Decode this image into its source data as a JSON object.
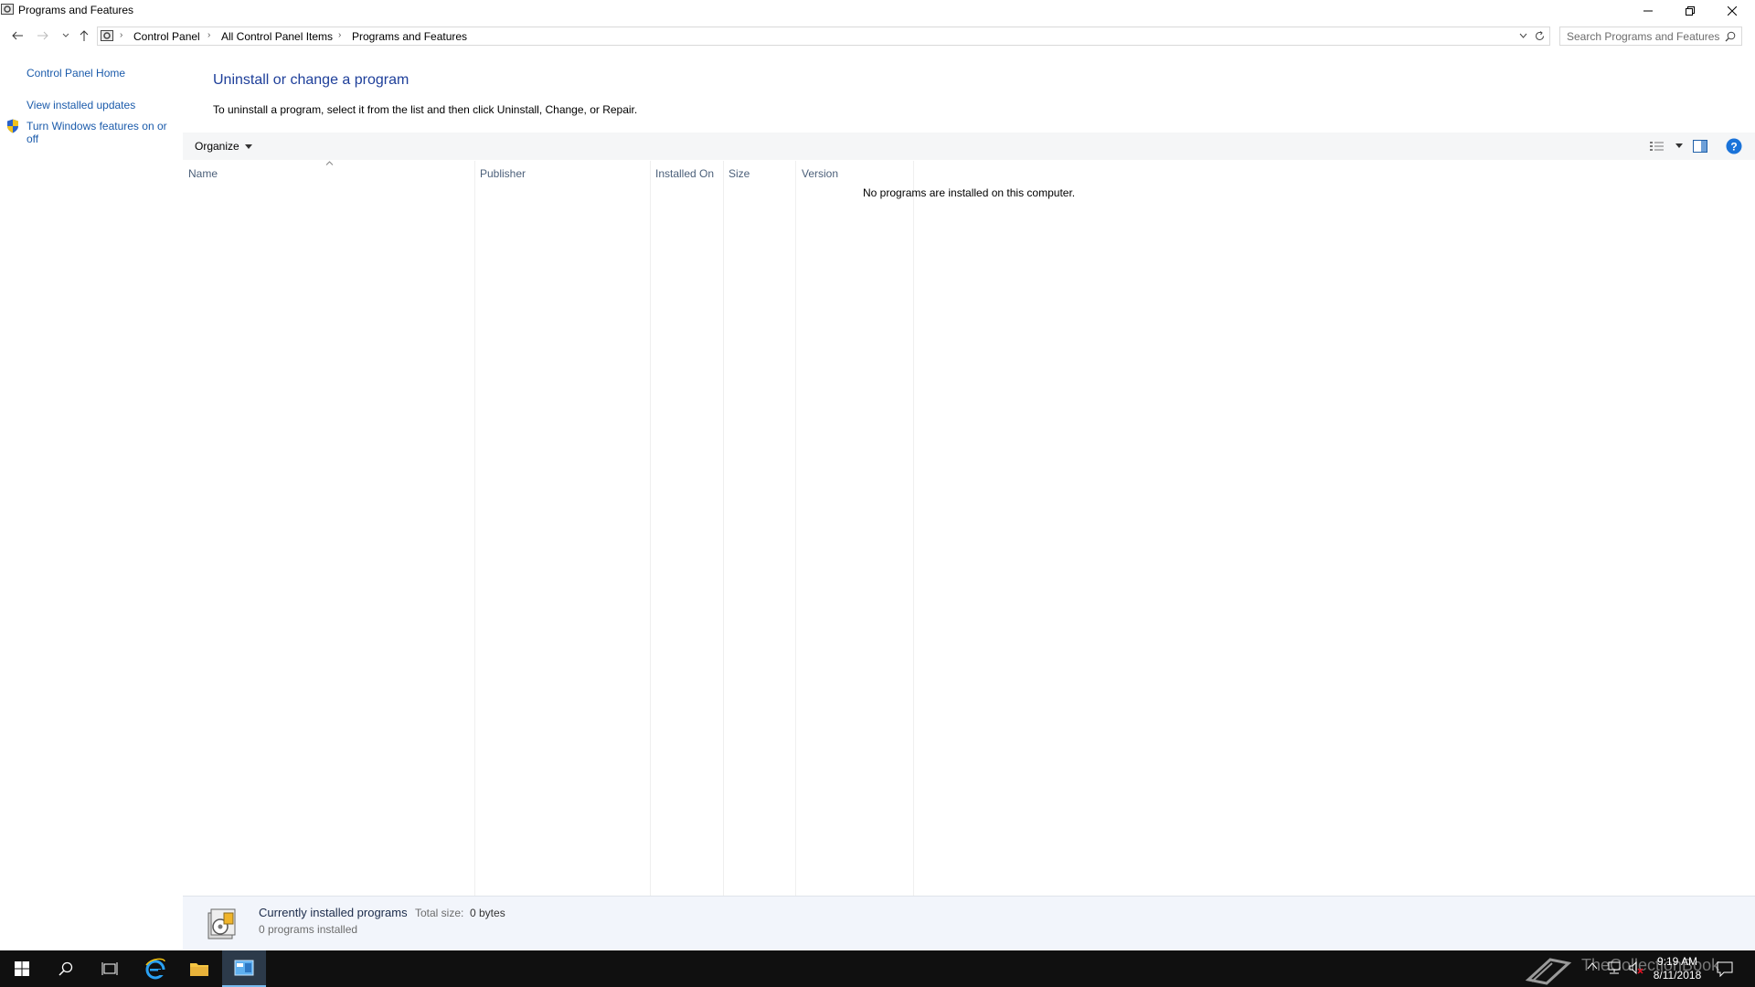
{
  "window": {
    "title": "Programs and Features"
  },
  "address": {
    "crumbs": [
      "Control Panel",
      "All Control Panel Items",
      "Programs and Features"
    ]
  },
  "search": {
    "placeholder": "Search Programs and Features"
  },
  "left_pane": {
    "home": "Control Panel Home",
    "updates": "View installed updates",
    "features_line1": "Turn Windows features on or",
    "features_line2": "off"
  },
  "main": {
    "heading": "Uninstall or change a program",
    "instructions": "To uninstall a program, select it from the list and then click Uninstall, Change, or Repair."
  },
  "toolbar": {
    "organize": "Organize"
  },
  "columns": [
    "Name",
    "Publisher",
    "Installed On",
    "Size",
    "Version"
  ],
  "list": {
    "empty_message": "No programs are installed on this computer."
  },
  "details": {
    "label": "Currently installed programs",
    "total_size_label": "Total size:",
    "total_size_value": "0 bytes",
    "count": "0 programs installed"
  },
  "taskbar": {
    "time": "9:19 AM",
    "date": "8/11/2018",
    "watermark": "TheCollectionBook"
  },
  "colors": {
    "link": "#1b5bab",
    "heading": "#1e3f9a",
    "taskbar": "#101010",
    "help": "#1a73d9"
  }
}
